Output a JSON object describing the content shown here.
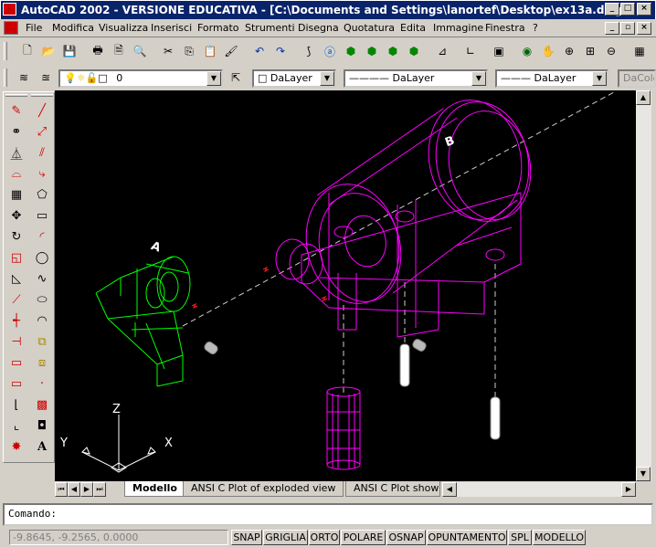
{
  "window": {
    "title": "AutoCAD 2002 - VERSIONE EDUCATIVA - [C:\\Documents and Settings\\lanortef\\Desktop\\ex13a.dwg]"
  },
  "menu": [
    "File",
    "Modifica",
    "Visualizza",
    "Inserisci",
    "Formato",
    "Strumenti",
    "Disegna",
    "Quotatura",
    "Edita",
    "Immagine",
    "Finestra",
    "?"
  ],
  "layers": {
    "current": "0",
    "color": "DaLayer",
    "linetype": "DaLayer",
    "lineweight": "DaLayer",
    "plotstyle": "DaColo"
  },
  "canvas": {
    "label_a": "A",
    "label_b": "B",
    "axis_x": "X",
    "axis_y": "Y",
    "axis_z": "Z"
  },
  "tabs": [
    "Modello",
    "ANSI C Plot of exploded view",
    "ANSI C Plot show"
  ],
  "command": {
    "prompt": "Comando:"
  },
  "status": {
    "coords": "-9.8645, -9.2565, 0.0000",
    "buttons": [
      "SNAP",
      "GRIGLIA",
      "ORTO",
      "POLARE",
      "OSNAP",
      "OPUNTAMENTO",
      "SPL",
      "MODELLO"
    ]
  },
  "colors": {
    "titlebar": "#0a246a",
    "magenta_part": "#ff00ff",
    "green_part": "#00ff00",
    "canvas": "#000000"
  }
}
